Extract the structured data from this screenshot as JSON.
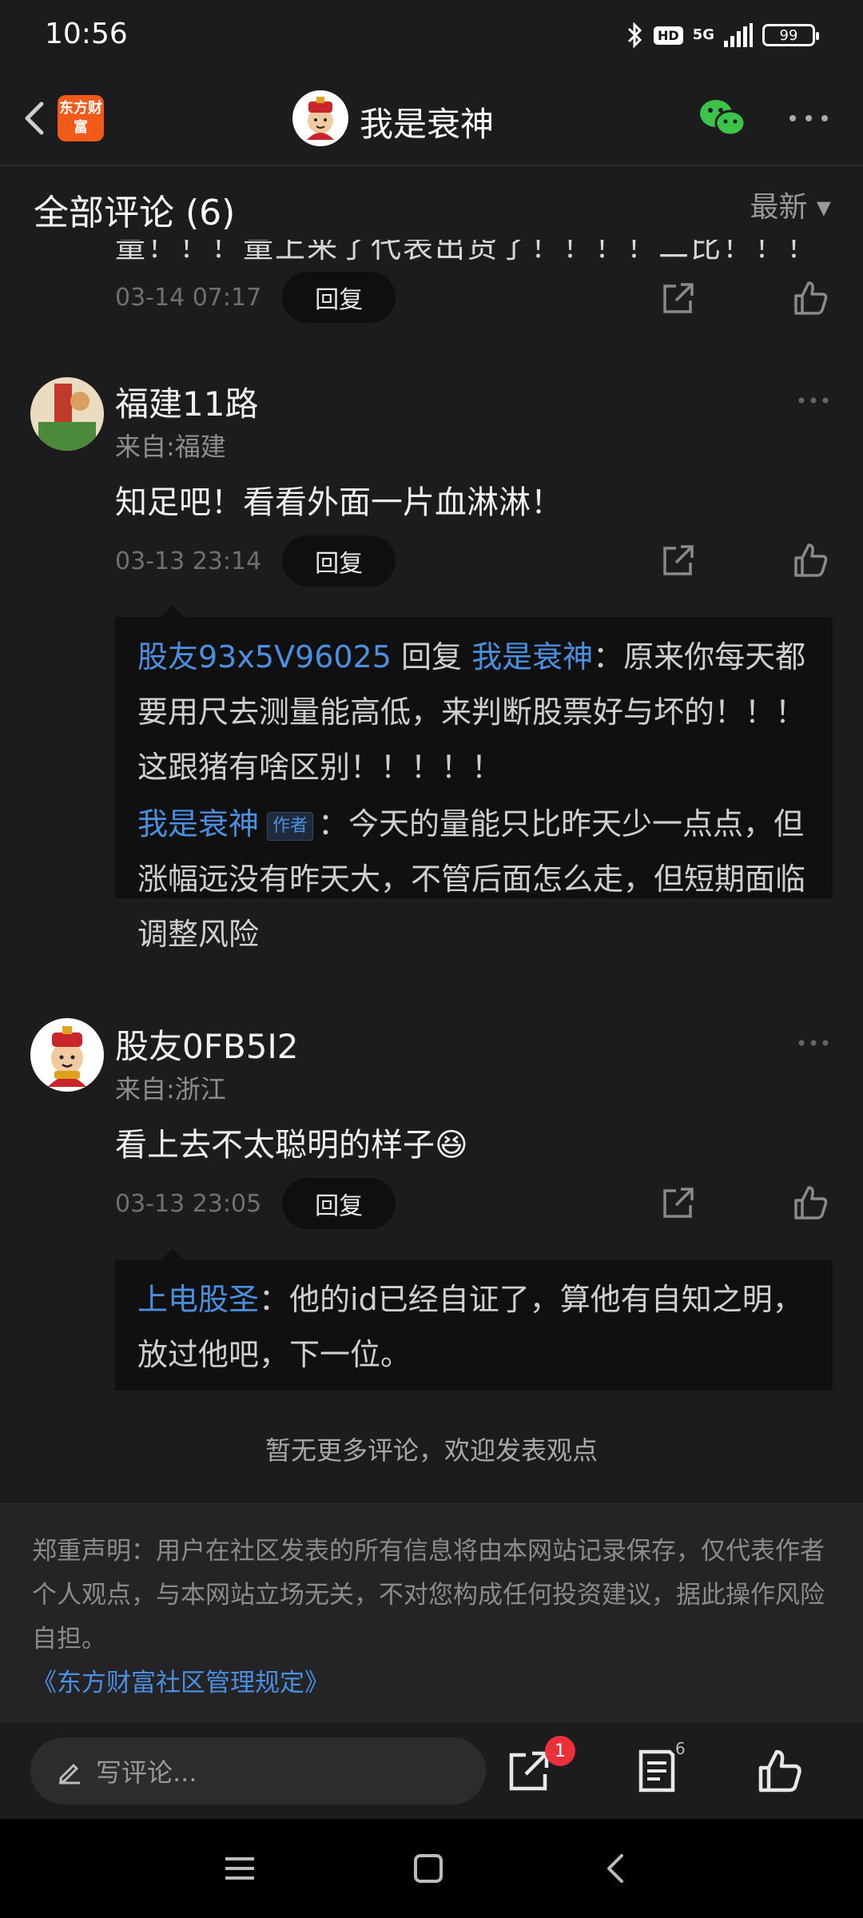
{
  "status_bar": {
    "time": "10:56",
    "hd": "HD",
    "network": "5G",
    "battery": "99"
  },
  "nav": {
    "brand_logo_text": "东方财富",
    "title": "我是衰神"
  },
  "section": {
    "title": "全部评论 (6)",
    "sort_label": "最新 ▾"
  },
  "comments": {
    "clipped_text": "量！！！量上来了代表出货了！！！！二比！！！",
    "clipped": {
      "time": "03-14 07:17",
      "reply_label": "回复"
    },
    "c1": {
      "username": "福建11路",
      "location": "来自:福建",
      "body": "知足吧！看看外面一片血淋淋！",
      "time": "03-13 23:14",
      "reply_label": "回复",
      "replies": [
        {
          "author": "股友93x5V96025",
          "connector": " 回复 ",
          "target": "我是衰神",
          "text": "：原来你每天都要用尺去测量能高低，来判断股票好与坏的！！！这跟猪有啥区别！！！！！"
        },
        {
          "author": "我是衰神",
          "tag": "作者",
          "text": "：今天的量能只比昨天少一点点，但涨幅远没有昨天大，不管后面怎么走，但短期面临调整风险"
        }
      ]
    },
    "c2": {
      "username": "股友0FB5I2",
      "location": "来自:浙江",
      "body": "看上去不太聪明的样子",
      "emoji": "😆",
      "time": "03-13 23:05",
      "reply_label": "回复",
      "replies": [
        {
          "author": "上电股圣",
          "text": "：他的id已经自证了，算他有自知之明，放过他吧，下一位。"
        }
      ]
    },
    "no_more": "暂无更多评论，欢迎发表观点"
  },
  "disclaimer": {
    "text": "郑重声明：用户在社区发表的所有信息将由本网站记录保存，仅代表作者个人观点，与本网站立场无关，不对您构成任何投资建议，据此操作风险自担。",
    "link": "《东方财富社区管理规定》"
  },
  "action_bar": {
    "input_placeholder": "写评论...",
    "share_badge": "1",
    "comment_count": "6"
  }
}
